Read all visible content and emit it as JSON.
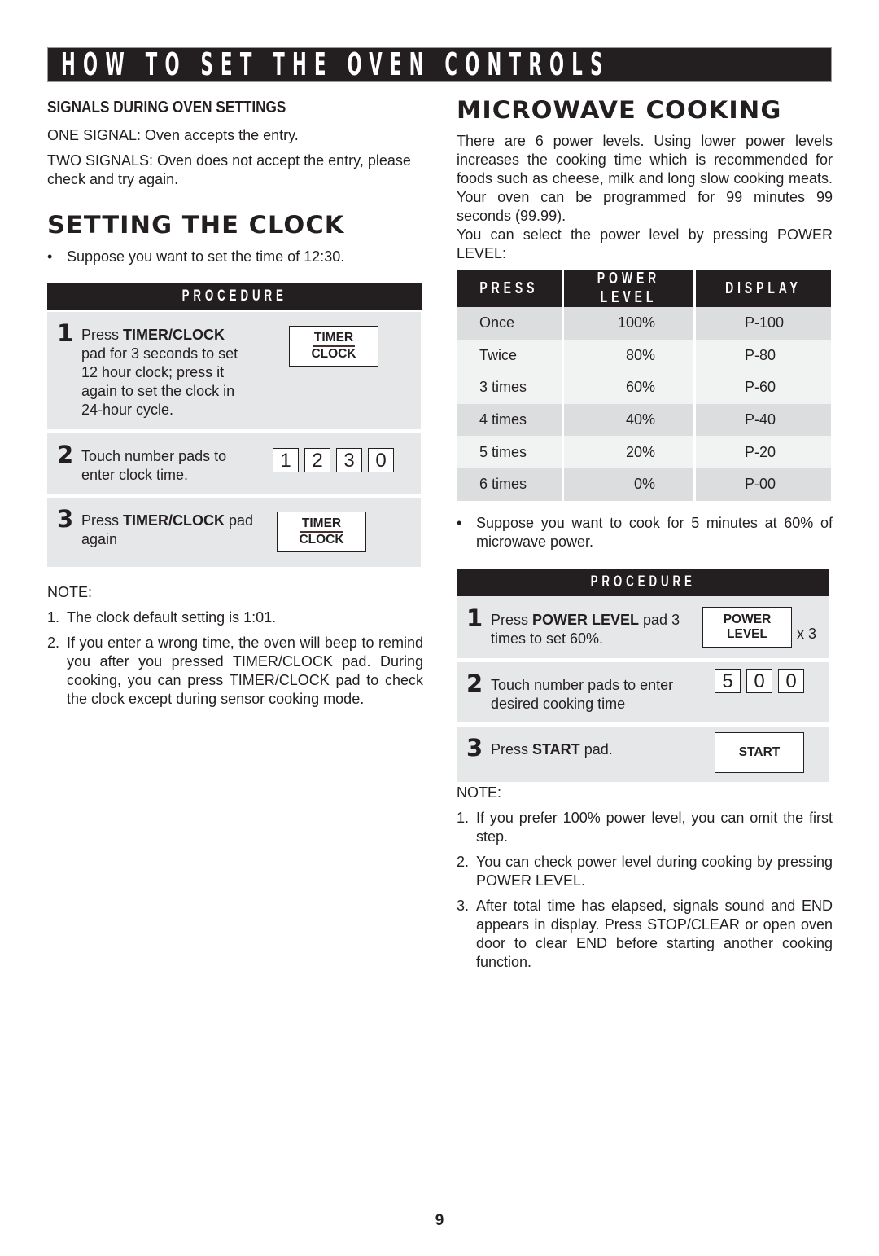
{
  "banner": {
    "title": "HOW TO SET THE OVEN CONTROLS"
  },
  "signals": {
    "heading": "SIGNALS DURING OVEN SETTINGS",
    "one_signal": "ONE SIGNAL: Oven accepts the entry.",
    "two_signals": "TWO SIGNALS: Oven does not accept the entry, please check and try again."
  },
  "clock": {
    "heading": "SETTING THE CLOCK",
    "bullet": "Suppose you want to set the time of 12:30.",
    "procedure_label": "PROCEDURE",
    "steps": [
      {
        "num": "1",
        "pre": "Press ",
        "bold": "TIMER/CLOCK",
        "post": " pad for 3 seconds to set 12 hour clock; press it again to set the clock in 24-hour cycle.",
        "pad_top": "TIMER",
        "pad_bottom": "CLOCK"
      },
      {
        "num": "2",
        "text": "Touch number pads to enter clock time.",
        "digits": [
          "1",
          "2",
          "3",
          "0"
        ]
      },
      {
        "num": "3",
        "pre": "Press ",
        "bold": "TIMER/CLOCK",
        "post": " pad again",
        "pad_top": "TIMER",
        "pad_bottom": "CLOCK"
      }
    ],
    "note_label": "NOTE:",
    "notes": [
      {
        "n": "1.",
        "text": "The clock default setting is 1:01."
      },
      {
        "n": "2.",
        "text": "If you enter a wrong time, the oven will beep to remind you after you pressed TIMER/CLOCK pad. During cooking, you can press TIMER/CLOCK pad to check the clock except during sensor cooking mode."
      }
    ]
  },
  "microwave": {
    "heading": "MICROWAVE COOKING",
    "intro": "There are 6 power levels. Using lower power levels increases the cooking time which is recommended for foods such as cheese, milk and long slow cooking meats. Your oven can be programmed for 99 minutes 99 seconds (99.99).",
    "select": "You can select the power level by pressing POWER LEVEL:",
    "table": {
      "headers": [
        "PRESS",
        "POWER LEVEL",
        "DISPLAY"
      ],
      "rows": [
        [
          "Once",
          "100%",
          "P-100"
        ],
        [
          "Twice",
          "80%",
          "P-80"
        ],
        [
          "3 times",
          "60%",
          "P-60"
        ],
        [
          "4 times",
          "40%",
          "P-40"
        ],
        [
          "5 times",
          "20%",
          "P-20"
        ],
        [
          "6 times",
          "0%",
          "P-00"
        ]
      ]
    },
    "bullet": "Suppose you want to cook for 5 minutes at 60% of microwave power.",
    "procedure_label": "PROCEDURE",
    "steps": [
      {
        "num": "1",
        "pre": "Press ",
        "bold": "POWER LEVEL",
        "post": " pad 3 times to set 60%.",
        "pad_top": "POWER",
        "pad_bottom": "LEVEL",
        "multiplier": "x 3"
      },
      {
        "num": "2",
        "text": "Touch number pads to enter desired cooking time",
        "digits": [
          "5",
          "0",
          "0"
        ]
      },
      {
        "num": "3",
        "pre": "Press ",
        "bold": "START",
        "post": " pad.",
        "pad": "START"
      }
    ],
    "note_label": "NOTE:",
    "notes": [
      {
        "n": "1.",
        "text": "If you prefer 100% power level, you can omit the first step."
      },
      {
        "n": "2.",
        "text": "You can check power level during cooking by pressing POWER LEVEL."
      },
      {
        "n": "3.",
        "text": "After total time has elapsed, signals sound and END appears in display. Press STOP/CLEAR or open oven door to clear END before starting another cooking function."
      }
    ]
  },
  "page_number": "9"
}
